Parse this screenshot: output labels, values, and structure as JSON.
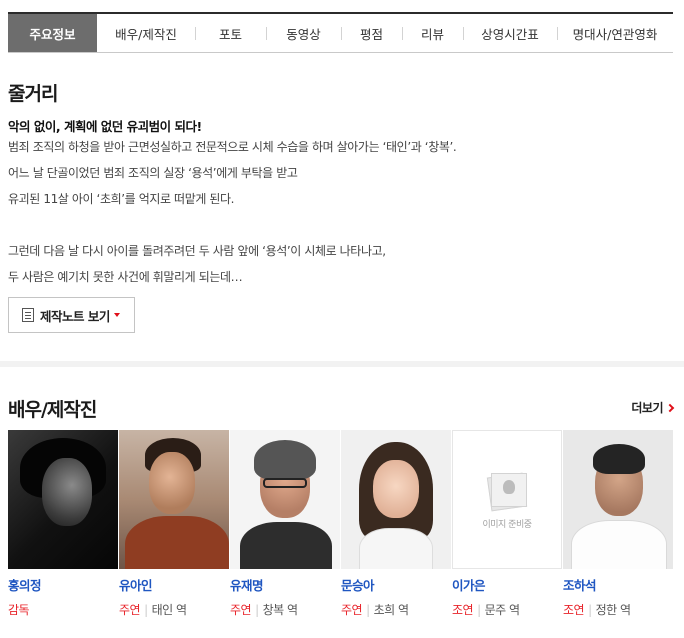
{
  "tabs": [
    "주요정보",
    "배우/제작진",
    "포토",
    "동영상",
    "평점",
    "리뷰",
    "상영시간표",
    "명대사/연관영화"
  ],
  "synopsis": {
    "title": "줄거리",
    "tagline": "악의 없이, 계획에 없던 유괴범이 되다!",
    "lines": [
      "범죄 조직의 하청을 받아 근면성실하고 전문적으로 시체 수습을 하며 살아가는 ‘태인’과 ‘창복’.",
      " 어느 날 단골이었던 범죄 조직의 실장 ‘용석’에게 부탁을 받고",
      " 유괴된 11살 아이 ‘초희’를 억지로 떠맡게 된다.",
      "",
      " 그런데 다음 날 다시 아이를 돌려주려던 두 사람 앞에 ‘용석’이 시체로 나타나고,",
      " 두 사람은 예기치 못한 사건에 휘말리게 되는데…"
    ],
    "note_button": "제작노트 보기"
  },
  "cast": {
    "title": "배우/제작진",
    "more": "더보기",
    "people": [
      {
        "name": "홍의정",
        "role": "감독",
        "character": "",
        "icon": "photo-hong"
      },
      {
        "name": "유아인",
        "role": "주연",
        "character": "태인 역",
        "icon": "photo-yoo"
      },
      {
        "name": "유재명",
        "role": "주연",
        "character": "창복 역",
        "icon": "photo-yu"
      },
      {
        "name": "문승아",
        "role": "주연",
        "character": "초희 역",
        "icon": "photo-moon"
      },
      {
        "name": "이가은",
        "role": "조연",
        "character": "문주 역",
        "icon": "image-placeholder",
        "placeholder_text": "이미지 준비중"
      },
      {
        "name": "조하석",
        "role": "조연",
        "character": "정한 역",
        "icon": "photo-cho"
      }
    ]
  },
  "colors": {
    "accent": "#e8242b",
    "link": "#1f56c1",
    "active_tab": "#6d6d6d"
  }
}
